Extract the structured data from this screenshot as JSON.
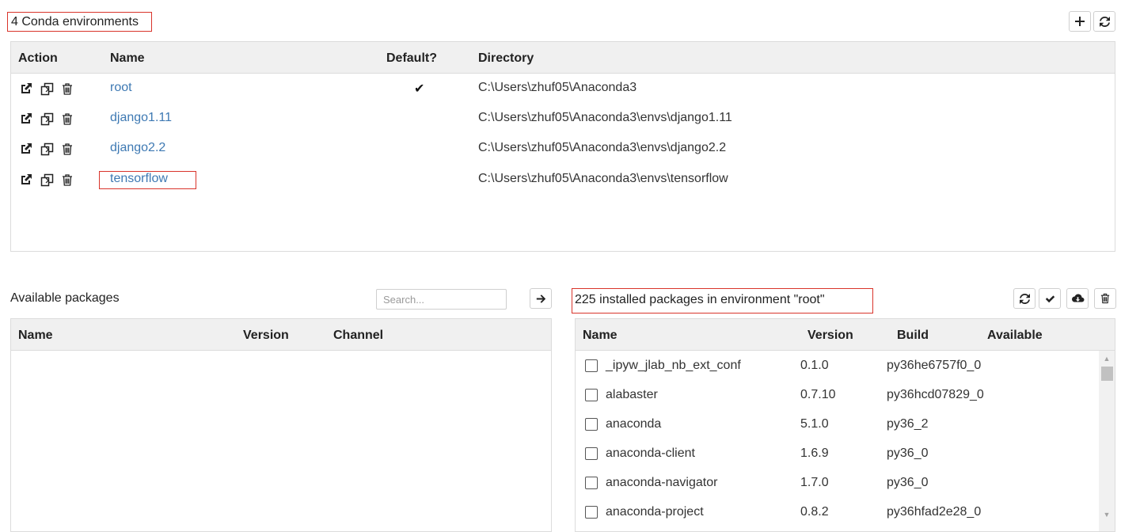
{
  "environments": {
    "title": "4 Conda environments",
    "columns": {
      "action": "Action",
      "name": "Name",
      "default": "Default?",
      "directory": "Directory"
    },
    "rows": [
      {
        "name": "root",
        "default_mark": "✔",
        "directory": "C:\\Users\\zhuf05\\Anaconda3"
      },
      {
        "name": "django1.11",
        "default_mark": "",
        "directory": "C:\\Users\\zhuf05\\Anaconda3\\envs\\django1.11"
      },
      {
        "name": "django2.2",
        "default_mark": "",
        "directory": "C:\\Users\\zhuf05\\Anaconda3\\envs\\django2.2"
      },
      {
        "name": "tensorflow",
        "default_mark": "",
        "directory": "C:\\Users\\zhuf05\\Anaconda3\\envs\\tensorflow"
      }
    ],
    "row_action_icons": [
      "external-link-icon",
      "clone-icon",
      "trash-icon"
    ],
    "toolbar_icons": [
      "plus-icon",
      "refresh-icon"
    ]
  },
  "available": {
    "title": "Available packages",
    "search_placeholder": "Search...",
    "columns": {
      "name": "Name",
      "version": "Version",
      "channel": "Channel"
    },
    "install_icon": "arrow-right-icon"
  },
  "installed": {
    "title": "225 installed packages in environment \"root\"",
    "columns": {
      "name": "Name",
      "version": "Version",
      "build": "Build",
      "available": "Available"
    },
    "toolbar_icons": [
      "refresh-icon",
      "check-icon",
      "cloud-download-icon",
      "trash-icon"
    ],
    "packages": [
      {
        "name": "_ipyw_jlab_nb_ext_conf",
        "version": "0.1.0",
        "build": "py36he6757f0_0",
        "available": ""
      },
      {
        "name": "alabaster",
        "version": "0.7.10",
        "build": "py36hcd07829_0",
        "available": ""
      },
      {
        "name": "anaconda",
        "version": "5.1.0",
        "build": "py36_2",
        "available": ""
      },
      {
        "name": "anaconda-client",
        "version": "1.6.9",
        "build": "py36_0",
        "available": ""
      },
      {
        "name": "anaconda-navigator",
        "version": "1.7.0",
        "build": "py36_0",
        "available": ""
      },
      {
        "name": "anaconda-project",
        "version": "0.8.2",
        "build": "py36hfad2e28_0",
        "available": ""
      }
    ]
  },
  "colors": {
    "link": "#3e79b3",
    "highlight_border": "#d9342b",
    "header_bg": "#f0f0f0"
  }
}
